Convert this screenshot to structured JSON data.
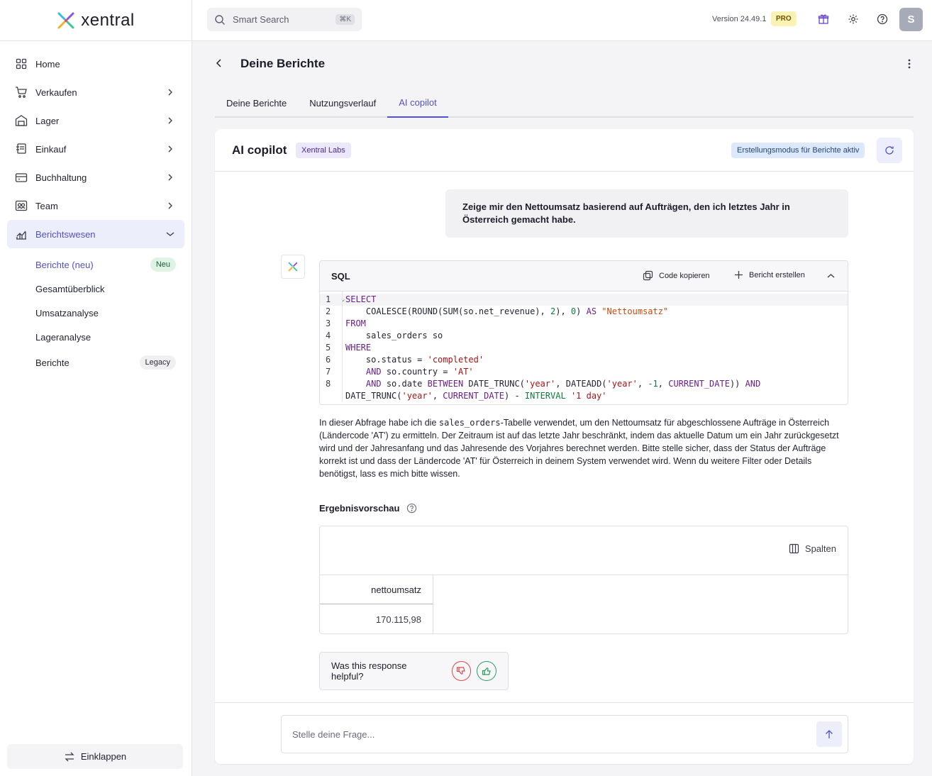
{
  "brand": {
    "name": "xentral"
  },
  "sidebar": {
    "items": [
      {
        "label": "Home"
      },
      {
        "label": "Verkaufen"
      },
      {
        "label": "Lager"
      },
      {
        "label": "Einkauf"
      },
      {
        "label": "Buchhaltung"
      },
      {
        "label": "Team"
      },
      {
        "label": "Berichtswesen"
      }
    ],
    "subitems": [
      {
        "label": "Berichte (neu)",
        "badge": "Neu"
      },
      {
        "label": "Gesamtüberblick"
      },
      {
        "label": "Umsatzanalyse"
      },
      {
        "label": "Lageranalyse"
      },
      {
        "label": "Berichte",
        "badge": "Legacy"
      }
    ],
    "collapse_label": "Einklappen"
  },
  "topbar": {
    "search_placeholder": "Smart Search",
    "search_shortcut": "⌘K",
    "version": "Version 24.49.1",
    "plan": "PRO",
    "avatar_initial": "S"
  },
  "page": {
    "title": "Deine Berichte",
    "tabs": [
      {
        "label": "Deine Berichte"
      },
      {
        "label": "Nutzungsverlauf"
      },
      {
        "label": "AI copilot"
      }
    ]
  },
  "copilot": {
    "title": "AI copilot",
    "labs_badge": "Xentral Labs",
    "mode_badge": "Erstellungsmodus für Berichte aktiv",
    "user_message": "Zeige mir den Nettoumsatz basierend auf Aufträgen, den ich letztes Jahr in Österreich gemacht habe.",
    "sql": {
      "label": "SQL",
      "copy_label": "Code kopieren",
      "create_label": "Bericht erstellen",
      "line_numbers": [
        "1",
        "2",
        "3",
        "4",
        "5",
        "6",
        "7",
        "8"
      ]
    },
    "explanation": {
      "before": "In dieser Abfrage habe ich die ",
      "code": "sales_orders",
      "after": "-Tabelle verwendet, um den Nettoumsatz für abgeschlossene Aufträge in Österreich (Ländercode 'AT') zu ermitteln. Der Zeitraum ist auf das letzte Jahr beschränkt, indem das aktuelle Datum um ein Jahr zurückgesetzt wird und der Jahresanfang und das Jahresende des Vorjahres berechnet werden. Bitte stelle sicher, dass der Status der Aufträge korrekt ist und dass der Ländercode 'AT' für Österreich in deinem System verwendet wird. Wenn du weitere Filter oder Details benötigst, lass es mich bitte wissen."
    },
    "preview": {
      "title": "Ergebnisvorschau",
      "columns_label": "Spalten",
      "header": "nettoumsatz",
      "value": "170.115,98"
    },
    "feedback_question": "Was this response helpful?",
    "input_placeholder": "Stelle deine Frage..."
  },
  "colors": {
    "accent": "#5151c4",
    "active_bg": "#eceefb"
  }
}
